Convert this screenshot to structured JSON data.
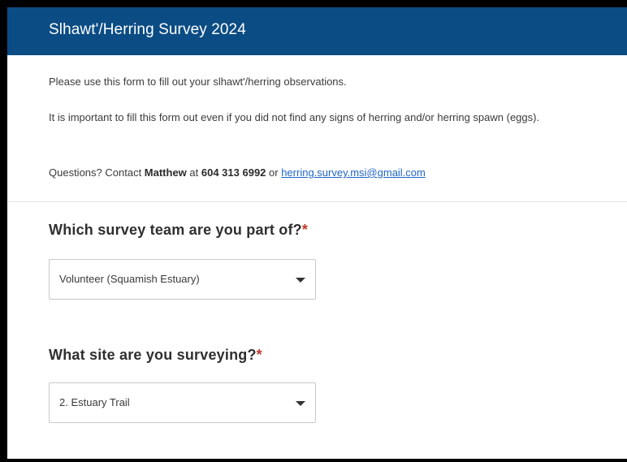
{
  "header": {
    "title": "Slhawt'/Herring Survey 2024"
  },
  "description": {
    "line1": "Please use this form to fill out your slhawt'/herring observations.",
    "line2": "It is important to fill this form out even if you did not find any signs of herring and/or herring spawn (eggs).",
    "contact_prefix": "Questions? Contact ",
    "contact_name": "Matthew",
    "contact_at": " at ",
    "contact_phone": "604 313 6992",
    "contact_or": " or ",
    "contact_email": "herring.survey.msi@gmail.com"
  },
  "questions": [
    {
      "label": "Which survey team are you part of?",
      "required_mark": "*",
      "selected": "Volunteer (Squamish Estuary)"
    },
    {
      "label": "What site are you surveying?",
      "required_mark": "*",
      "selected": "2. Estuary Trail"
    }
  ],
  "icons": {
    "dropdown": "chevron-down-icon"
  },
  "colors": {
    "header_bg": "#0b4c84",
    "link": "#1f66c6",
    "required": "#c0392b"
  }
}
